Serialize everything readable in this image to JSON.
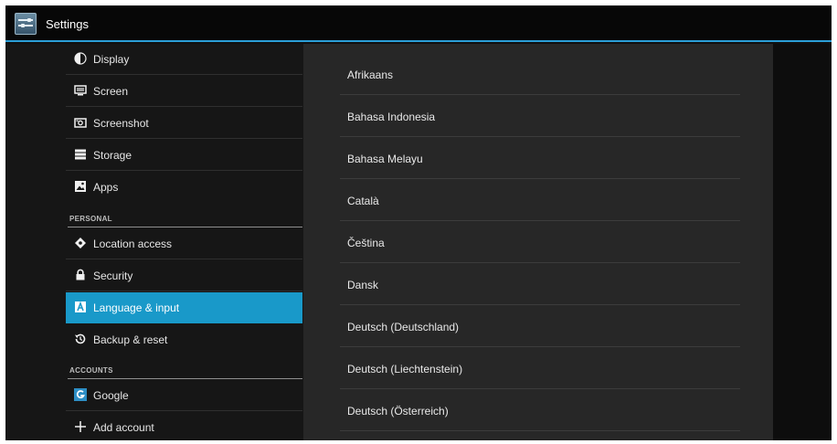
{
  "action_bar": {
    "title": "Settings",
    "icon": "settings-sliders-icon"
  },
  "sidebar": {
    "device_items": [
      {
        "label": "Display",
        "icon": "display-brightness-icon"
      },
      {
        "label": "Screen",
        "icon": "screen-monitor-icon"
      },
      {
        "label": "Screenshot",
        "icon": "screenshot-camera-icon"
      },
      {
        "label": "Storage",
        "icon": "storage-icon"
      },
      {
        "label": "Apps",
        "icon": "apps-image-icon"
      }
    ],
    "personal_header": "PERSONAL",
    "personal_items": [
      {
        "label": "Location access",
        "icon": "location-icon"
      },
      {
        "label": "Security",
        "icon": "lock-icon"
      },
      {
        "label": "Language & input",
        "icon": "keyboard-a-icon",
        "selected": true
      },
      {
        "label": "Backup & reset",
        "icon": "backup-restore-icon"
      }
    ],
    "accounts_header": "ACCOUNTS",
    "account_items": [
      {
        "label": "Google",
        "icon": "google-g-icon"
      },
      {
        "label": "Add account",
        "icon": "plus-icon"
      }
    ]
  },
  "languages": [
    "Afrikaans",
    "Bahasa Indonesia",
    "Bahasa Melayu",
    "Català",
    "Čeština",
    "Dansk",
    "Deutsch (Deutschland)",
    "Deutsch (Liechtenstein)",
    "Deutsch (Österreich)"
  ],
  "colors": {
    "accent": "#1999c9",
    "action_bar_line": "#2b9fd8",
    "background": "#101010",
    "left_pane": "#161616",
    "right_pane": "#272727",
    "text": "#e6e6e6"
  }
}
